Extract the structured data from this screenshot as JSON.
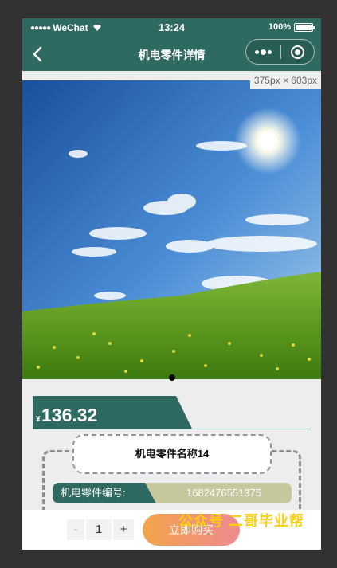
{
  "status_bar": {
    "carrier": "WeChat",
    "time": "13:24",
    "battery": "100%"
  },
  "nav": {
    "title": "机电零件详情"
  },
  "size_badge": "375px × 603px",
  "product": {
    "currency": "¥",
    "price": "136.32",
    "name": "机电零件名称14",
    "code_label": "机电零件编号:",
    "code_value": "1682476551375"
  },
  "cart": {
    "minus": "-",
    "quantity": "1",
    "plus": "+",
    "buy_label": "立即购买"
  },
  "watermark": "公众号 二哥毕业帮",
  "colors": {
    "theme": "#2e6a62",
    "code_bg": "#c6c79c",
    "buy_gradient_start": "#f3a44a",
    "buy_gradient_end": "#ee8a8f",
    "watermark": "#f9cf10"
  }
}
